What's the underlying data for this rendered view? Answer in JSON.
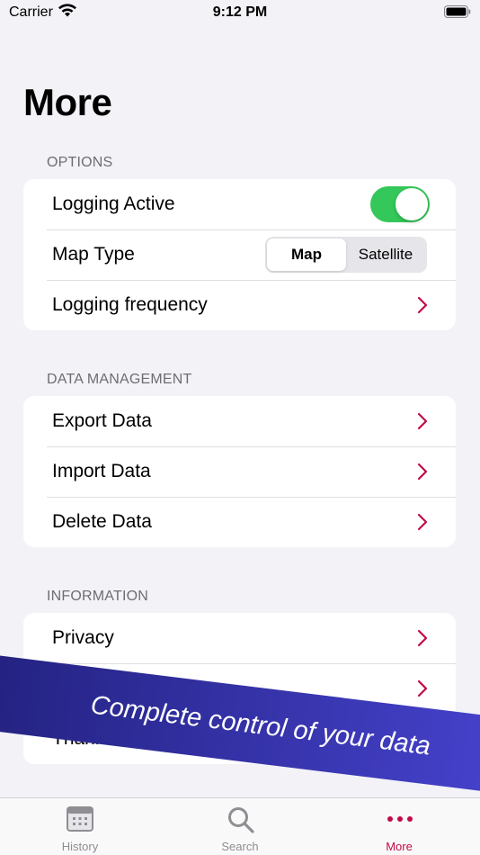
{
  "status": {
    "carrier": "Carrier",
    "time": "9:12 PM"
  },
  "title": "More",
  "sections": [
    {
      "header": "OPTIONS",
      "rows": [
        {
          "label": "Logging Active",
          "toggle_on": true
        },
        {
          "label": "Map Type",
          "segments": [
            "Map",
            "Satellite"
          ],
          "selected": "Map"
        },
        {
          "label": "Logging frequency"
        }
      ]
    },
    {
      "header": "DATA MANAGEMENT",
      "rows": [
        {
          "label": "Export Data"
        },
        {
          "label": "Import Data"
        },
        {
          "label": "Delete Data"
        }
      ]
    },
    {
      "header": "INFORMATION",
      "rows": [
        {
          "label": "Privacy"
        },
        {
          "label": ""
        },
        {
          "label": "Thanks & Feedback"
        }
      ]
    }
  ],
  "banner": "Complete control of your data",
  "tabs": [
    {
      "label": "History",
      "icon": "calendar-icon"
    },
    {
      "label": "Search",
      "icon": "search-icon"
    },
    {
      "label": "More",
      "icon": "more-dots-icon",
      "active": true
    }
  ],
  "colors": {
    "accent": "#c20a48",
    "toggle_on": "#34c759",
    "banner_start": "#22217e",
    "banner_end": "#4743cf"
  }
}
